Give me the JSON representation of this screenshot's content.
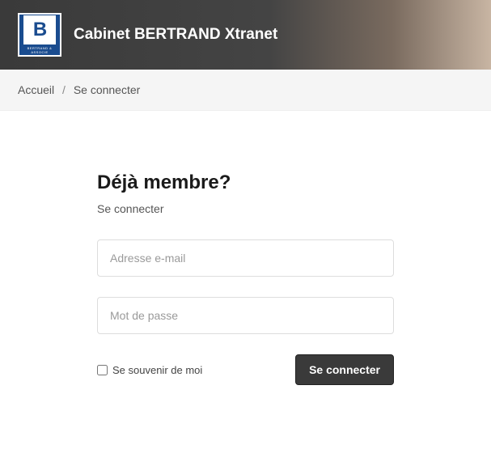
{
  "header": {
    "logo_text": "B",
    "logo_sub": "BERTRAND & ASSOCIE",
    "title": "Cabinet BERTRAND Xtranet"
  },
  "breadcrumb": {
    "home": "Accueil",
    "sep": "/",
    "current": "Se connecter"
  },
  "login": {
    "title": "Déjà membre?",
    "subtitle": "Se connecter",
    "email_placeholder": "Adresse e-mail",
    "password_placeholder": "Mot de passe",
    "remember_label": "Se souvenir de moi",
    "submit_label": "Se connecter"
  }
}
